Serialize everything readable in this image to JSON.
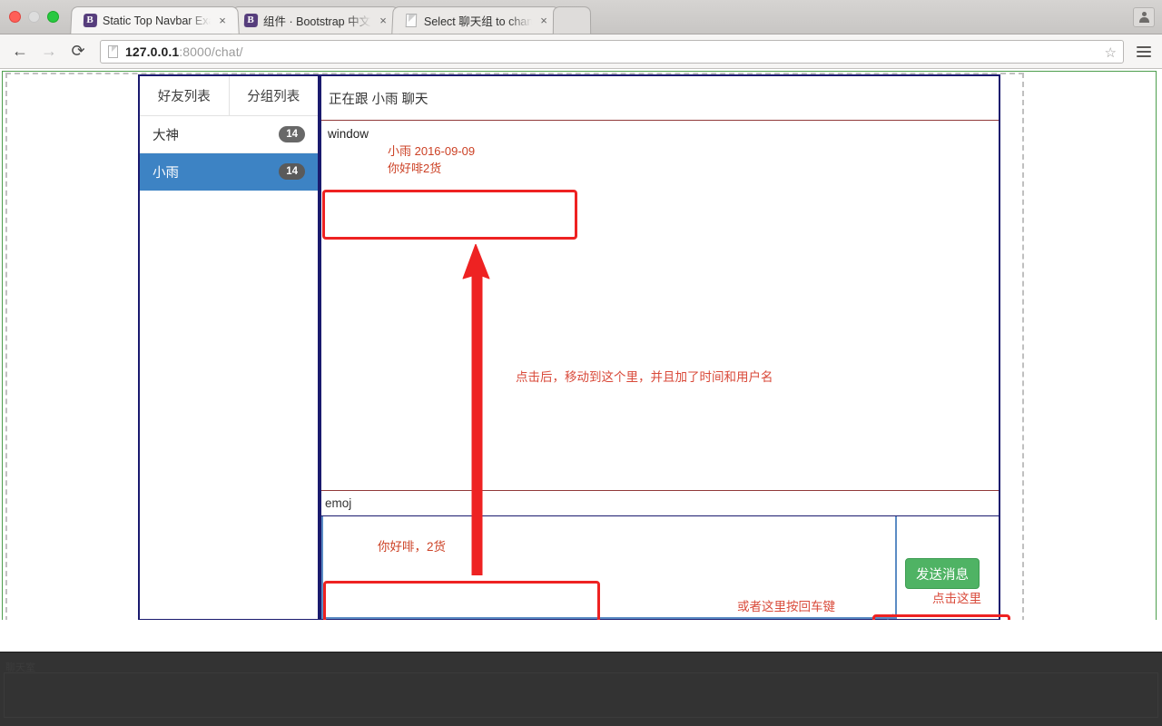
{
  "window": {
    "traffic_lights": [
      "close",
      "minimize",
      "zoom"
    ]
  },
  "tabs": [
    {
      "title": "Static Top Navbar Example",
      "favicon": "bootstrap-b-icon",
      "active": true,
      "close_label": "×"
    },
    {
      "title": "组件 · Bootstrap 中文文档",
      "favicon": "bootstrap-b-icon",
      "active": false,
      "close_label": "×"
    },
    {
      "title": "Select 聊天组 to change | D",
      "favicon": "page-doc-icon",
      "active": false,
      "close_label": "×"
    }
  ],
  "toolbar": {
    "back_icon": "←",
    "forward_icon": "→",
    "reload_icon": "⟳",
    "url_host": "127.0.0.1",
    "url_rest": ":8000/chat/",
    "star_icon": "☆",
    "menu_icon": "hamburger-icon"
  },
  "sidebar": {
    "tabs": [
      {
        "label": "好友列表",
        "active": true
      },
      {
        "label": "分组列表",
        "active": false
      }
    ],
    "friends": [
      {
        "name": "大神",
        "badge": "14",
        "active": false
      },
      {
        "name": "小雨",
        "badge": "14",
        "active": true
      }
    ]
  },
  "chat": {
    "header": "正在跟 小雨 聊天",
    "messages": [
      {
        "window_label": "window",
        "meta": "小雨 2016-09-09",
        "text": "你好啡2货"
      }
    ],
    "emoj_label": "emoj",
    "compose_value": "你好啡，2货",
    "send_button": "发送消息"
  },
  "annotations": {
    "moved_here": "点击后，移动到这个里，并且加了时间和用户名",
    "enter_key": "或者这里按回车键",
    "click_here": "点击这里",
    "arrow_color": "#ee2222",
    "box_color": "#ee2222",
    "text_color": "#d94a3a"
  },
  "footer": {
    "console_text": "聊天室"
  },
  "colors": {
    "panel_border": "#1a1a6e",
    "selected_friend": "#3d83c4",
    "send_green": "#4fb364",
    "page_outline_green": "#4d9e4d",
    "message_red": "#cc4125"
  }
}
